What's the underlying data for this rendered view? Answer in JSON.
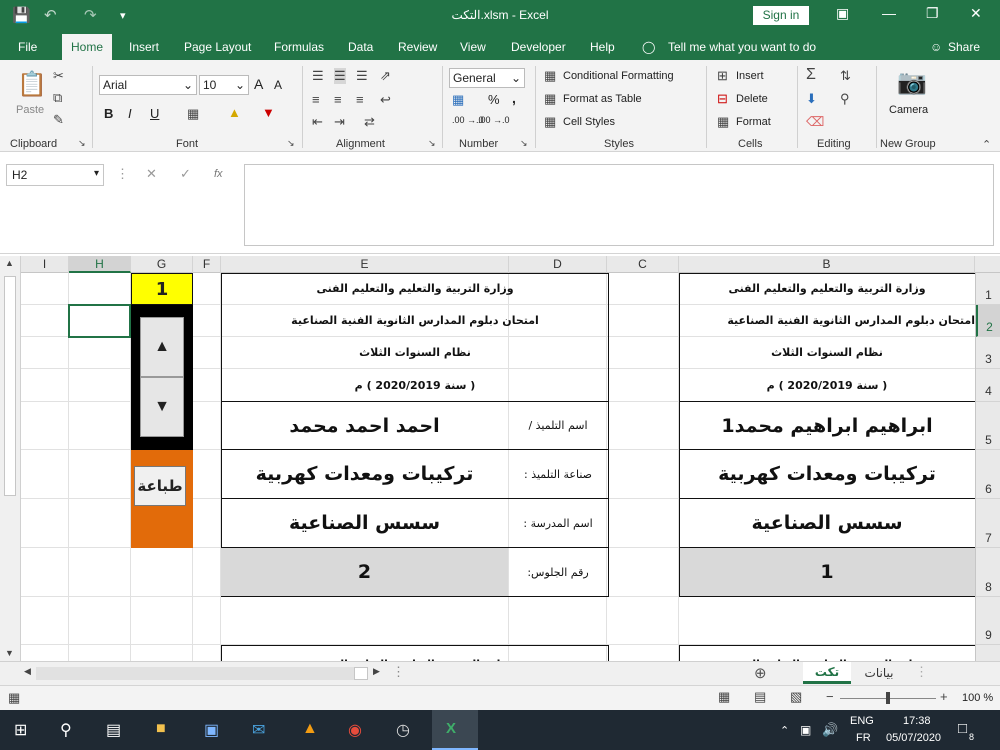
{
  "window": {
    "title": "التكت.xlsm  -  Excel",
    "sign_in": "Sign in"
  },
  "menu": {
    "tabs": [
      "File",
      "Home",
      "Insert",
      "Page Layout",
      "Formulas",
      "Data",
      "Review",
      "View",
      "Developer",
      "Help"
    ],
    "tell_me": "Tell me what you want to do",
    "share": "Share"
  },
  "ribbon": {
    "clipboard": {
      "paste": "Paste",
      "label": "Clipboard"
    },
    "font": {
      "name": "Arial",
      "size": "10",
      "bold": "B",
      "italic": "I",
      "underline": "U",
      "grow": "A",
      "shrink": "A",
      "label": "Font"
    },
    "alignment": {
      "label": "Alignment"
    },
    "number": {
      "format": "General",
      "percent": "%",
      "comma": ",",
      "dec_inc": ".00 →.0",
      "dec_dec": ".00 →.0",
      "label": "Number"
    },
    "styles": {
      "conditional": "Conditional Formatting",
      "table": "Format as Table",
      "cell": "Cell Styles",
      "label": "Styles"
    },
    "cells": {
      "insert": "Insert",
      "delete": "Delete",
      "format": "Format",
      "label": "Cells"
    },
    "editing": {
      "label": "Editing"
    },
    "camera": {
      "label": "Camera",
      "group": "New Group"
    }
  },
  "formula_bar": {
    "name_box": "H2",
    "fx": "fx",
    "value": ""
  },
  "columns": [
    {
      "name": "I",
      "w": 48
    },
    {
      "name": "H",
      "w": 62
    },
    {
      "name": "G",
      "w": 62
    },
    {
      "name": "F",
      "w": 28
    },
    {
      "name": "E",
      "w": 288
    },
    {
      "name": "D",
      "w": 98
    },
    {
      "name": "C",
      "w": 72
    },
    {
      "name": "B",
      "w": 296
    }
  ],
  "rows": [
    {
      "n": "1",
      "h": 32
    },
    {
      "n": "2",
      "h": 32
    },
    {
      "n": "3",
      "h": 32
    },
    {
      "n": "4",
      "h": 33
    },
    {
      "n": "5",
      "h": 48
    },
    {
      "n": "6",
      "h": 49
    },
    {
      "n": "7",
      "h": 49
    },
    {
      "n": "8",
      "h": 49
    },
    {
      "n": "9",
      "h": 48
    }
  ],
  "sheet": {
    "counter": "1",
    "print_button": "طباعة",
    "card_right": {
      "h1": "وزارة التربية والتعليم والتعليم الفنى",
      "h2": "امتحان دبلوم المدارس الثانوية الفنية الصناعية",
      "h3": "نظام السنوات الثلاث",
      "h4": "( سنة 2020/2019 ) م",
      "name": "ابراهيم ابراهيم محمد1",
      "trade": "تركيبات ومعدات كهربية",
      "school": "سسس الصناعية",
      "seat": "1"
    },
    "card_left": {
      "h1": "وزارة التربية والتعليم والتعليم الفنى",
      "h2": "امتحان دبلوم المدارس الثانوية الفنية الصناعية",
      "h3": "نظام السنوات الثلاث",
      "h4": "( سنة 2020/2019 ) م",
      "name_label": "اسم التلميذ  /",
      "trade_label": "صناعة التلميذ :",
      "school_label": "اسم المدرسة :",
      "seat_label": "رقم الجلوس:",
      "name": "احمد احمد محمد",
      "trade": "تركيبات ومعدات كهربية",
      "school": "سسس الصناعية",
      "seat": "2"
    },
    "partial_row10_left": "وزارة التربية والتعليم والتعليم الفنى",
    "partial_row10_right": "وزارة التربية والتعليم والتعليم الفنى"
  },
  "sheets": {
    "tabs": [
      "تكت",
      "بيانات"
    ],
    "active": "تكت"
  },
  "status": {
    "zoom": "100 %"
  },
  "taskbar": {
    "lang": "ENG",
    "layout": "FR",
    "time": "17:38",
    "date": "05/07/2020",
    "notif": "8"
  },
  "colors": {
    "excel_green": "#217346",
    "yellow": "#ffff00",
    "orange": "#e26b0a",
    "gray_cell": "#d9d9d9",
    "spin_bg": "#000000"
  }
}
